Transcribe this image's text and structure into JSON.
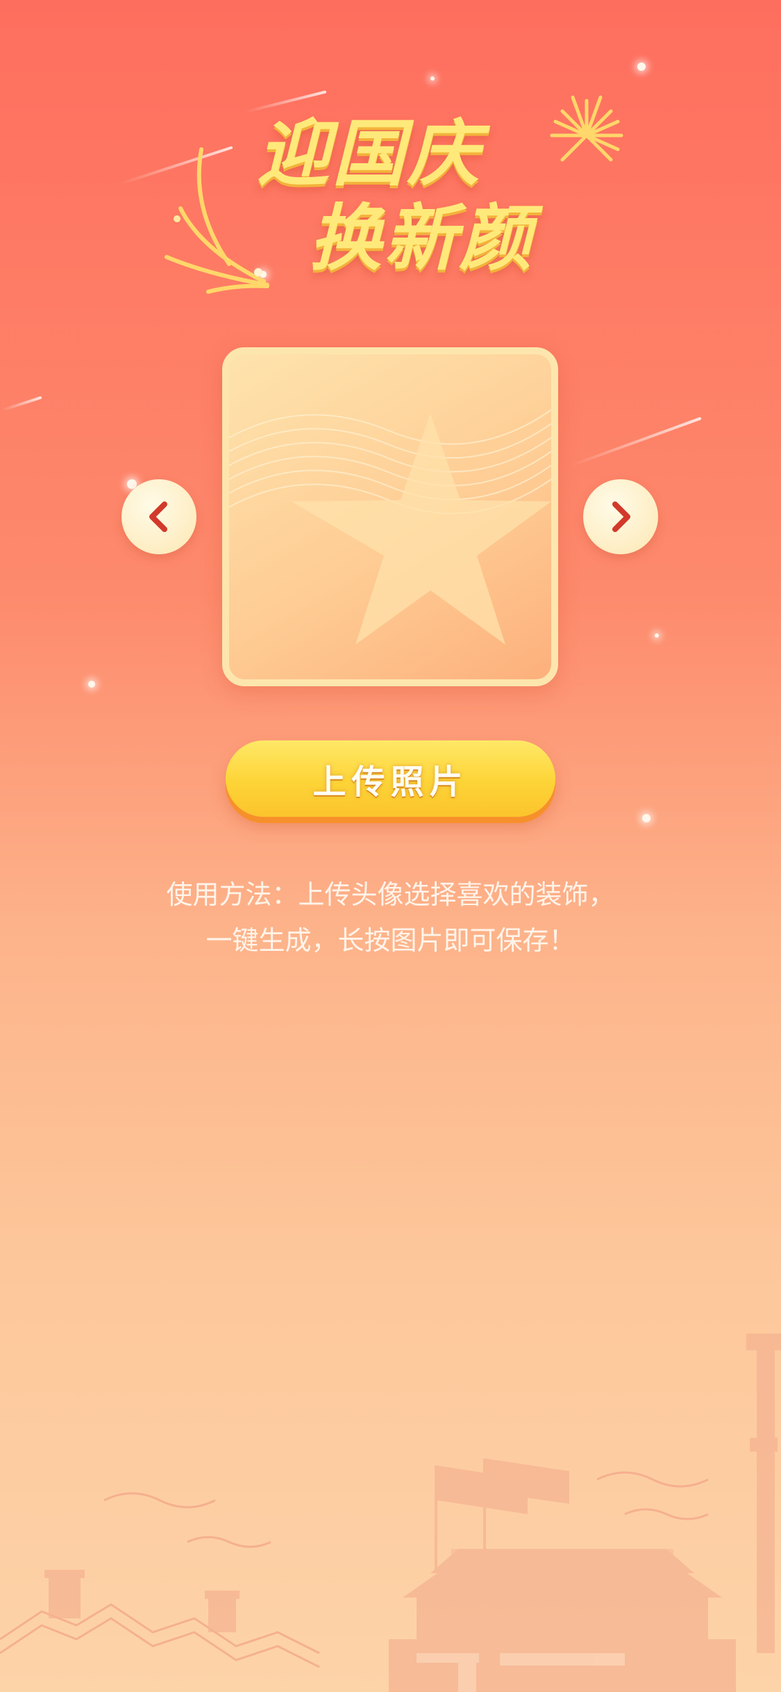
{
  "header": {
    "title_line1": "迎国庆",
    "title_line2": "换新颜"
  },
  "avatar_frame": {
    "icon": "star-icon"
  },
  "carousel": {
    "prev_icon": "chevron-left-icon",
    "next_icon": "chevron-right-icon"
  },
  "upload": {
    "label": "上传照片"
  },
  "instructions": {
    "line1": "使用方法：上传头像选择喜欢的装饰，",
    "line2": "一键生成，长按图片即可保存！"
  },
  "colors": {
    "background_top": "#fe6e5e",
    "background_bottom": "#fdd3a8",
    "title_gold": "#ffe97a",
    "button_yellow": "#fdd437",
    "arrow_red": "#d2392b"
  }
}
